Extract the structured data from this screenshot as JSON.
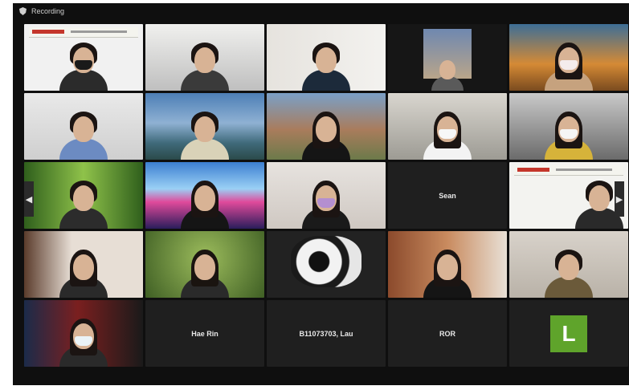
{
  "meeting": {
    "topbar_label": "Recording"
  },
  "tiles": {
    "r4c2_name": "Hae Rin",
    "r4c3_name": "B11073703, Lau",
    "r4c4_name": "ROR",
    "r3c4_name": "Sean",
    "r4c5_avatar": "L"
  },
  "nav": {
    "prev_icon": "◀",
    "next_icon": "▶"
  },
  "colors": {
    "window_bg": "#0f0f0f",
    "tile_bg": "#1f1f1f",
    "avatar_green": "#5fa42b"
  }
}
